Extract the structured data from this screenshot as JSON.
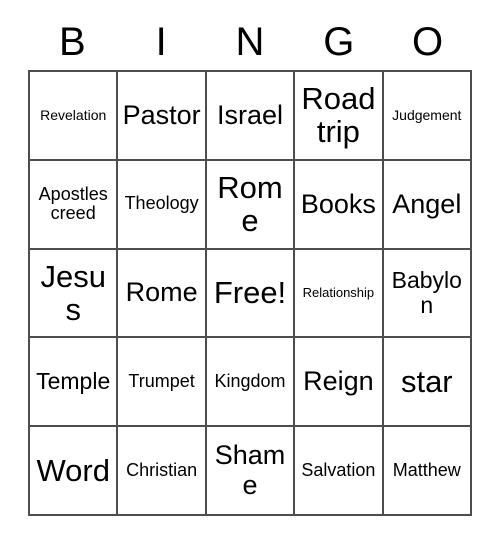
{
  "card": {
    "title_letters": [
      "B",
      "I",
      "N",
      "G",
      "O"
    ],
    "columns": 5,
    "rows": 5,
    "border_color": "#4d4d4d",
    "background_color": "#ffffff",
    "text_color": "#000000",
    "cells": [
      [
        {
          "label": "Revelation",
          "size": "fs-xs"
        },
        {
          "label": "Pastor",
          "size": "fs-lg"
        },
        {
          "label": "Israel",
          "size": "fs-lg"
        },
        {
          "label": "Road trip",
          "size": "fs-xl"
        },
        {
          "label": "Judgement",
          "size": "fs-xs"
        }
      ],
      [
        {
          "label": "Apostles creed",
          "size": "fs-sm"
        },
        {
          "label": "Theology",
          "size": "fs-sm"
        },
        {
          "label": "Rome",
          "size": "fs-xl"
        },
        {
          "label": "Books",
          "size": "fs-lg"
        },
        {
          "label": "Angel",
          "size": "fs-lg"
        }
      ],
      [
        {
          "label": "Jesus",
          "size": "fs-xl"
        },
        {
          "label": "Rome",
          "size": "fs-lg"
        },
        {
          "label": "Free!",
          "size": "fs-xl"
        },
        {
          "label": "Relationship",
          "size": "fs-xxs"
        },
        {
          "label": "Babylon",
          "size": "fs-md"
        }
      ],
      [
        {
          "label": "Temple",
          "size": "fs-md"
        },
        {
          "label": "Trumpet",
          "size": "fs-sm"
        },
        {
          "label": "Kingdom",
          "size": "fs-sm"
        },
        {
          "label": "Reign",
          "size": "fs-lg"
        },
        {
          "label": "star",
          "size": "fs-xl"
        }
      ],
      [
        {
          "label": "Word",
          "size": "fs-xl"
        },
        {
          "label": "Christian",
          "size": "fs-sm"
        },
        {
          "label": "Shame",
          "size": "fs-lg"
        },
        {
          "label": "Salvation",
          "size": "fs-sm"
        },
        {
          "label": "Matthew",
          "size": "fs-sm"
        }
      ]
    ]
  }
}
